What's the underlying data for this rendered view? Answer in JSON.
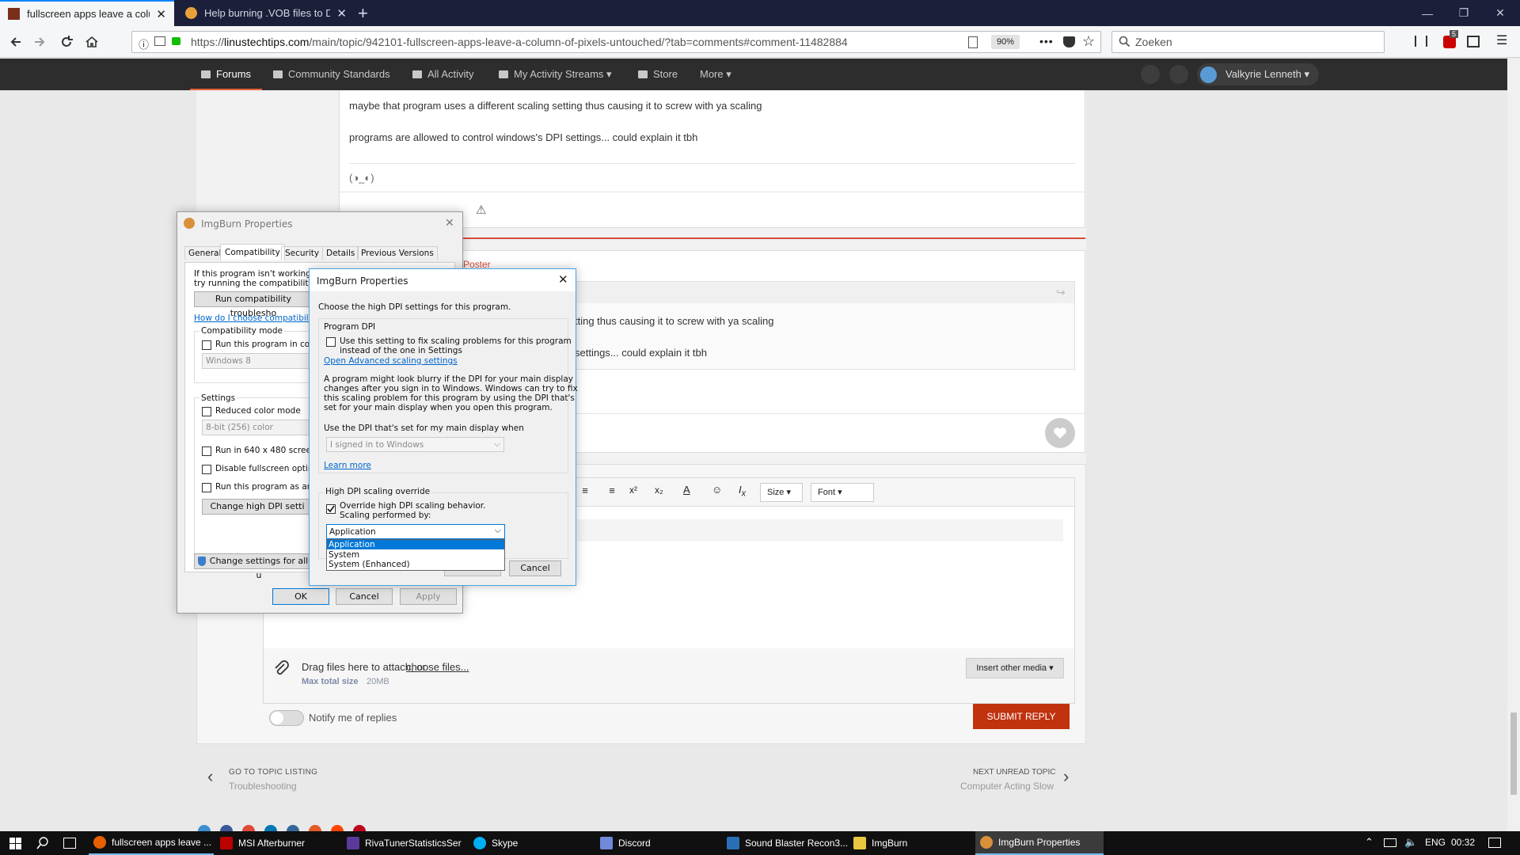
{
  "browser": {
    "tabs": [
      {
        "title": "fullscreen apps leave a column of pixels untouched"
      },
      {
        "title": "Help burning .VOB files to DVD"
      }
    ],
    "url_prefix": "https://",
    "url_host": "linustechtips.com",
    "url_path": "/main/topic/942101-fullscreen-apps-leave-a-column-of-pixels-untouched/?tab=comments#comment-11482884",
    "zoom": "90%",
    "search_placeholder": "Zoeken",
    "addon_badge": "5"
  },
  "site_nav": {
    "items": [
      "Forums",
      "Community Standards",
      "All Activity",
      "My Activity Streams",
      "Store",
      "More"
    ],
    "user": "Valkyrie Lenneth"
  },
  "post": {
    "line1": "maybe that program uses a different scaling setting thus causing it to screw with ya scaling",
    "line2": "programs are allowed to control windows's DPI settings... could explain it tbh",
    "signature": "(◑_◐)"
  },
  "quote": {
    "poster_tag": "Poster",
    "line1_tail": "tting thus causing it to screw with ya scaling",
    "line2_tail": "settings... could explain it tbh"
  },
  "editor": {
    "size_label": "Size",
    "font_label": "Font",
    "attach_text": "Drag files here to attach, or",
    "attach_link": "choose files...",
    "max_size_label": "Max total size",
    "max_size_value": "20MB",
    "insert_media": "Insert other media",
    "notify": "Notify me of replies",
    "submit": "SUBMIT REPLY"
  },
  "topic_nav": {
    "prev_label": "GO TO TOPIC LISTING",
    "prev_title": "Troubleshooting",
    "next_label": "NEXT UNREAD TOPIC",
    "next_title": "Computer Acting Slow"
  },
  "props_dialog": {
    "title": "ImgBurn Properties",
    "tabs": [
      "General",
      "Compatibility",
      "Security",
      "Details",
      "Previous Versions"
    ],
    "intro_1": "If this program isn't working cor",
    "intro_2": "try running the compatibility trou",
    "run_troubleshooter": "Run compatibility troublesho",
    "choose_link": "How do I choose compatibility",
    "compat_mode_group": "Compatibility mode",
    "run_in_compat": "Run this program in comp",
    "compat_os": "Windows 8",
    "settings_group": "Settings",
    "reduced_color": "Reduced color mode",
    "color_depth": "8-bit (256) color",
    "run_640": "Run in 640 x 480 screen",
    "disable_fullscreen": "Disable fullscreen optimiz",
    "run_admin": "Run this program as an a",
    "change_dpi": "Change high DPI setti",
    "change_all_users": "Change settings for all u",
    "ok": "OK",
    "cancel": "Cancel",
    "apply": "Apply"
  },
  "dpi_dialog": {
    "title": "ImgBurn Properties",
    "heading": "Choose the high DPI settings for this program.",
    "program_dpi_group": "Program DPI",
    "use_setting_1": "Use this setting to fix scaling problems for this program",
    "use_setting_2": "instead of the one in Settings",
    "advanced_link": "Open Advanced scaling settings",
    "desc_1": "A program might look blurry if the DPI for your main display",
    "desc_2": "changes after you sign in to Windows. Windows can try to fix",
    "desc_3": "this scaling problem for this program by using the DPI that's",
    "desc_4": "set for your main display when you open this program.",
    "use_dpi_when": "Use the DPI that's set for my main display when",
    "signed_in": "I signed in to Windows",
    "learn_more": "Learn more",
    "override_group": "High DPI scaling override",
    "override_check": "Override high DPI scaling behavior.",
    "scaling_by": "Scaling performed by:",
    "selected": "Application",
    "options": [
      "Application",
      "System",
      "System (Enhanced)"
    ],
    "cancel": "Cancel"
  },
  "taskbar": {
    "items": [
      "fullscreen apps leave ...",
      "MSI Afterburner",
      "RivaTunerStatisticsSer",
      "Skype",
      "Discord",
      "Sound Blaster Recon3...",
      "ImgBurn",
      "ImgBurn Properties"
    ],
    "lang": "ENG",
    "time": "00:32"
  }
}
